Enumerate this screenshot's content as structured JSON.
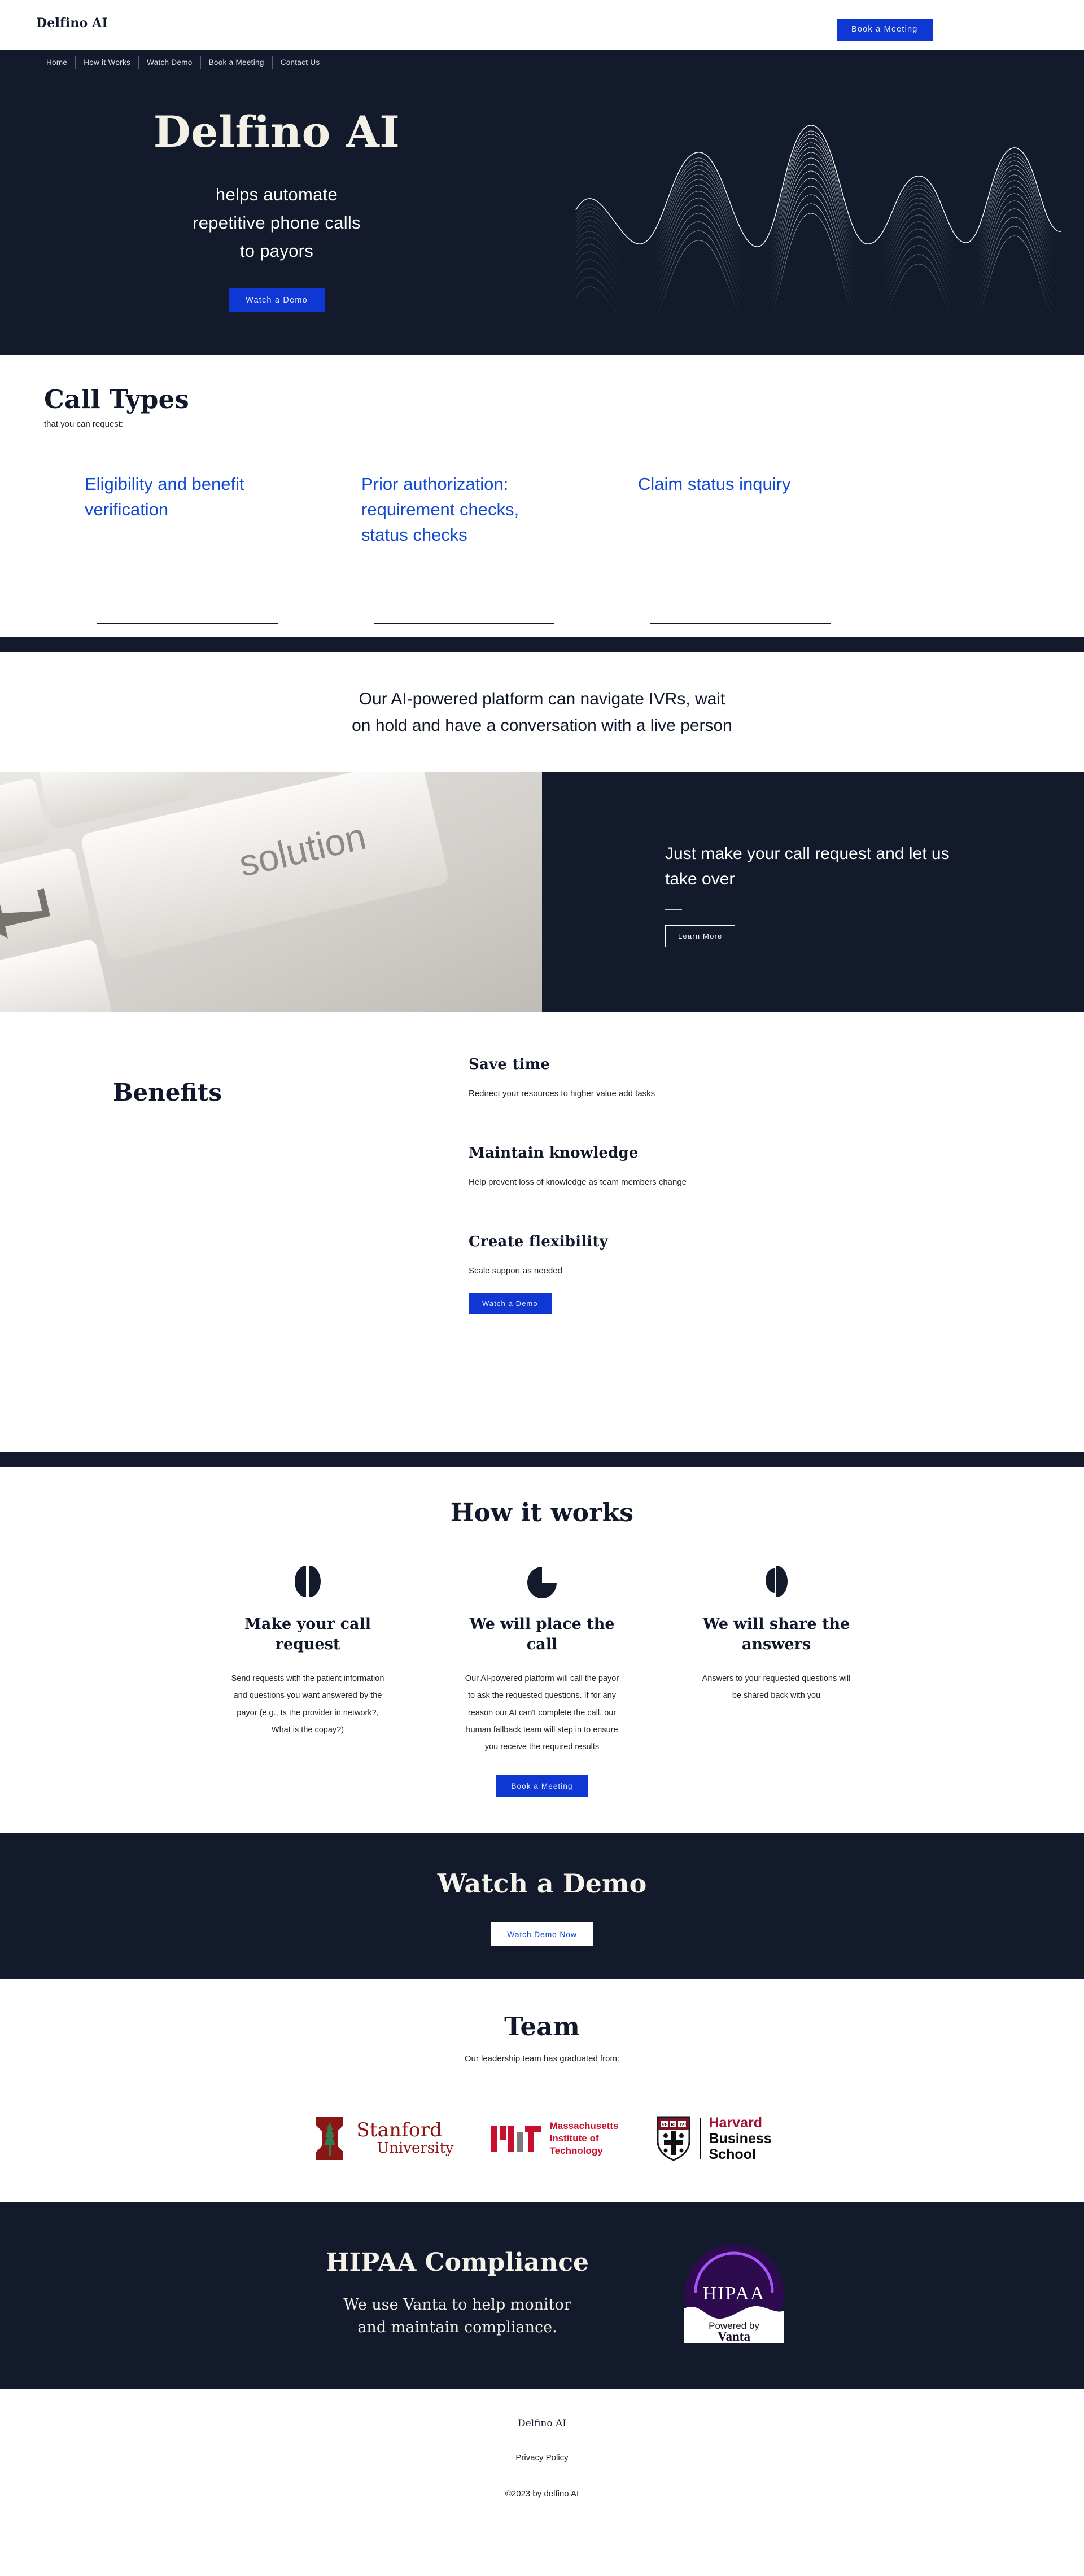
{
  "topbar": {
    "brand": "Delfino AI",
    "book_button": "Book a Meeting"
  },
  "nav": {
    "items": [
      {
        "label": "Home"
      },
      {
        "label": "How it Works"
      },
      {
        "label": "Watch Demo"
      },
      {
        "label": "Book a Meeting"
      },
      {
        "label": "Contact Us"
      }
    ]
  },
  "hero": {
    "title": "Delfino AI",
    "subtitle_line1": "helps automate",
    "subtitle_line2": "repetitive phone calls",
    "subtitle_line3": "to payors",
    "cta": "Watch a Demo",
    "graphic": "soundwave-graphic"
  },
  "call_types": {
    "title": "Call Types",
    "subtitle": "that you can request:",
    "items": [
      {
        "label": "Eligibility and benefit verification"
      },
      {
        "label": "Prior authorization: requirement checks, status checks"
      },
      {
        "label": "Claim status inquiry"
      }
    ]
  },
  "ivr": {
    "line1": "Our AI-powered platform can navigate IVRs, wait",
    "line2": "on hold and have a conversation with a live person"
  },
  "split": {
    "image_alt": "keyboard-solution-key-photo",
    "image_word": "solution",
    "panel_title": "Just make your call request and let us take over",
    "panel_cta": "Learn More"
  },
  "benefits": {
    "title": "Benefits",
    "items": [
      {
        "heading": "Save time",
        "body": "Redirect your resources to higher value add tasks"
      },
      {
        "heading": "Maintain knowledge",
        "body": "Help prevent loss of knowledge as team members change"
      },
      {
        "heading": "Create flexibility",
        "body": "Scale support as needed"
      }
    ],
    "cta": "Watch a Demo"
  },
  "how_it_works": {
    "title": "How it works",
    "steps": [
      {
        "icon": "two-half-circles-icon",
        "heading": "Make your call request",
        "body": "Send requests with the patient information and questions you want answered by the payor (e.g., Is the provider in network?, What is the copay?)"
      },
      {
        "icon": "pac-man-circle-icon",
        "heading": "We will place the call",
        "body": "Our AI-powered platform will call the payor to ask the requested questions. If for any reason our AI can't complete the call, our human fallback team will step in to ensure you receive the required results"
      },
      {
        "icon": "offset-half-circles-icon",
        "heading": "We will share the answers",
        "body": "Answers to your requested questions will be shared back with you"
      }
    ],
    "cta": "Book a Meeting"
  },
  "watch_demo": {
    "title": "Watch a Demo",
    "cta": "Watch Demo Now"
  },
  "team": {
    "title": "Team",
    "subtitle": "Our leadership team has graduated from:",
    "logos": [
      {
        "name": "stanford-university-logo",
        "line1": "Stanford",
        "line2": "University"
      },
      {
        "name": "mit-logo",
        "line1": "Massachusetts",
        "line2": "Institute of",
        "line3": "Technology"
      },
      {
        "name": "harvard-business-school-logo",
        "line1": "Harvard",
        "line2": "Business",
        "line3": "School"
      }
    ]
  },
  "hipaa": {
    "title": "HIPAA Compliance",
    "body_line1": "We use Vanta to help monitor",
    "body_line2": "and maintain compliance.",
    "badge": {
      "name": "hipaa-vanta-badge",
      "top_text": "HIPAA",
      "sub_text": "Powered by",
      "brand_text": "Vanta"
    }
  },
  "footer": {
    "brand": "Delfino AI",
    "privacy_link": "Privacy Policy",
    "copyright": "©2023 by delfino AI"
  },
  "colors": {
    "dark_navy": "#131a2b",
    "accent_blue": "#0f37d4",
    "link_blue": "#1249d4",
    "cream": "#f3f0e6",
    "stanford_red": "#8C1515",
    "mit_red": "#C8102E",
    "harvard_crimson": "#A41034",
    "vanta_purple": "#2d0b4e"
  }
}
